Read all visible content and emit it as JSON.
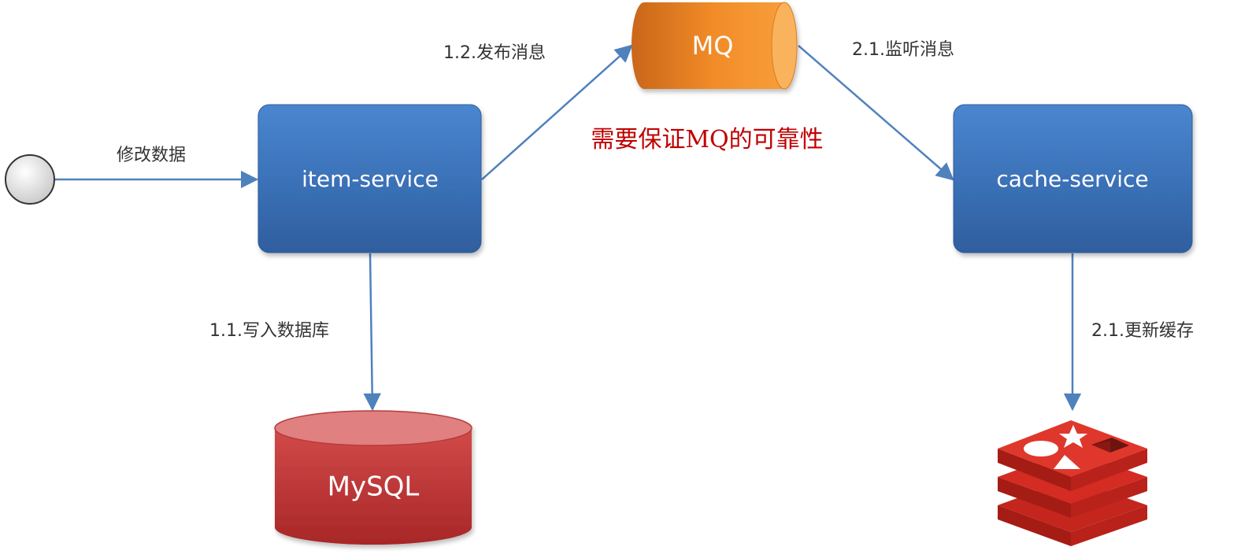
{
  "nodes": {
    "start": {
      "label": ""
    },
    "item_service": {
      "label": "item-service"
    },
    "mq": {
      "label": "MQ"
    },
    "cache_service": {
      "label": "cache-service"
    },
    "mysql": {
      "label": "MySQL"
    },
    "redis": {
      "label": "",
      "icon": "redis-logo-icon"
    }
  },
  "edges": {
    "modify_data": {
      "label": "修改数据"
    },
    "write_db": {
      "label": "1.1.写入数据库"
    },
    "publish": {
      "label": "1.2.发布消息"
    },
    "listen": {
      "label": "2.1.监听消息"
    },
    "update_cache": {
      "label": "2.1.更新缓存"
    }
  },
  "note": {
    "text": "需要保证MQ的可靠性"
  },
  "colors": {
    "service_blue": "#3a72b8",
    "arrow_blue": "#4f81bd",
    "mq_orange": "#f08a24",
    "mysql_red": "#c0392b",
    "redis_red": "#d52a22",
    "note_red": "#c00000"
  }
}
